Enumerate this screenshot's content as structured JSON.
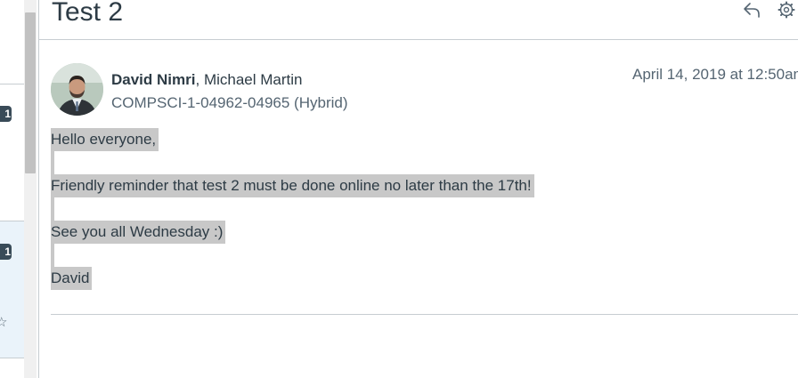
{
  "conversation_list": {
    "badges": [
      "1",
      "1"
    ]
  },
  "message": {
    "subject": "Test 2",
    "author": "David Nimri",
    "author_separator": ", ",
    "recipient": "Michael Martin",
    "course": "COMPSCI-1-04962-04965 (Hybrid)",
    "timestamp": "April 14, 2019 at 12:50am",
    "body_lines": [
      "Hello everyone,",
      "",
      "Friendly reminder that test 2 must be done online no later than the 17th!",
      "",
      "See you all Wednesday :)",
      "",
      "David"
    ]
  },
  "icons": {
    "reply": "reply-icon",
    "settings": "gear-icon",
    "star": "star-icon"
  }
}
